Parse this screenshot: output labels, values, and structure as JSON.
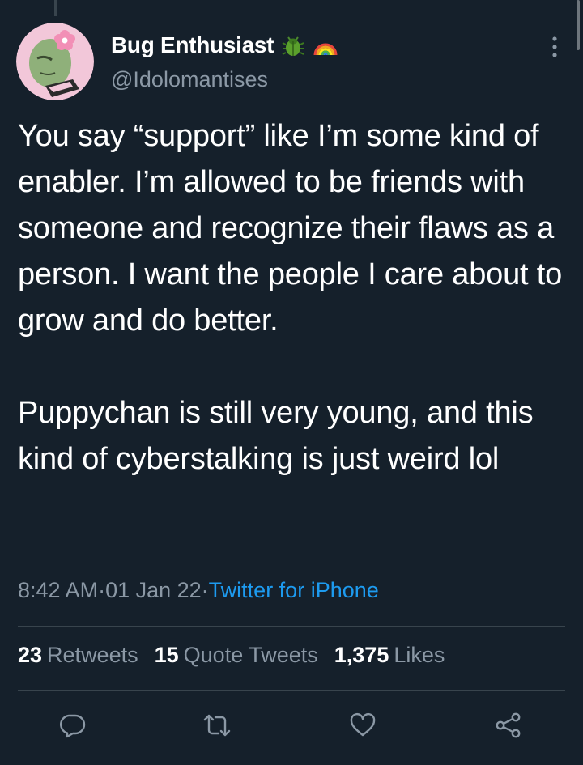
{
  "author": {
    "display_name": "Bug Enthusiast",
    "handle": "@Idolomantises",
    "avatar_icon": "green-mantis-avatar",
    "name_emojis": [
      "beetle-icon",
      "rainbow-icon"
    ]
  },
  "tweet": {
    "text": "You say “support” like I’m some kind of enabler. I’m allowed to be friends with someone and recognize their flaws as a person. I want the people I care about to grow and do better.\n\nPuppychan is still very young, and this kind of cyberstalking is just weird lol",
    "time": "8:42 AM",
    "date": "01 Jan 22",
    "separator": " · ",
    "source": "Twitter for iPhone"
  },
  "stats": {
    "retweets_count": "23",
    "retweets_label": "Retweets",
    "quotes_count": "15",
    "quotes_label": "Quote Tweets",
    "likes_count": "1,375",
    "likes_label": "Likes"
  },
  "colors": {
    "background": "#15202b",
    "text": "#ffffff",
    "secondary": "#8b98a5",
    "link": "#1d9bf0",
    "divider": "#38444d"
  }
}
